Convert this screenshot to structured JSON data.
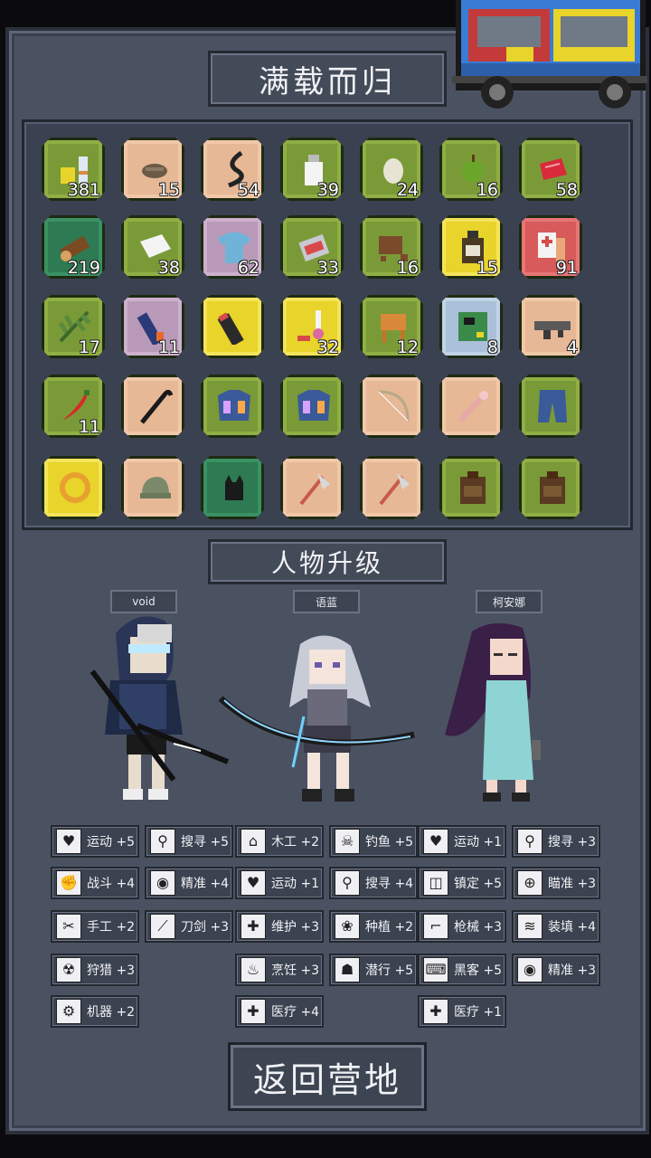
{
  "title": "满载而归",
  "section_title": "人物升级",
  "return_button": "返回营地",
  "inventory": [
    {
      "icon": "canned-food-bottle-icon",
      "count": "381",
      "bg": "g"
    },
    {
      "icon": "beef-jerky-icon",
      "count": "15",
      "bg": "t"
    },
    {
      "icon": "rope-icon",
      "count": "54",
      "bg": "t"
    },
    {
      "icon": "milk-bottle-icon",
      "count": "39",
      "bg": "g"
    },
    {
      "icon": "egg-icon",
      "count": "24",
      "bg": "g"
    },
    {
      "icon": "apple-icon",
      "count": "16",
      "bg": "g"
    },
    {
      "icon": "raw-meat-icon",
      "count": "58",
      "bg": "g"
    },
    {
      "icon": "wood-log-icon",
      "count": "219",
      "bg": "e"
    },
    {
      "icon": "cloth-icon",
      "count": "38",
      "bg": "g"
    },
    {
      "icon": "tshirt-icon",
      "count": "62",
      "bg": "p"
    },
    {
      "icon": "canned-meat-icon",
      "count": "33",
      "bg": "g"
    },
    {
      "icon": "chocolate-icon",
      "count": "16",
      "bg": "g"
    },
    {
      "icon": "medicine-bottle-icon",
      "count": "15",
      "bg": "y"
    },
    {
      "icon": "first-aid-icon",
      "count": "91",
      "bg": "r"
    },
    {
      "icon": "herb-icon",
      "count": "17",
      "bg": "g"
    },
    {
      "icon": "tube-icon",
      "count": "11",
      "bg": "p"
    },
    {
      "icon": "battery-icon",
      "count": "",
      "bg": "y"
    },
    {
      "icon": "chemical-vial-icon",
      "count": "32",
      "bg": "y"
    },
    {
      "icon": "wood-chip-icon",
      "count": "12",
      "bg": "g"
    },
    {
      "icon": "circuit-board-icon",
      "count": "8",
      "bg": "b"
    },
    {
      "icon": "rifle-icon",
      "count": "4",
      "bg": "t"
    },
    {
      "icon": "chili-pepper-icon",
      "count": "11",
      "bg": "g"
    },
    {
      "icon": "crowbar-icon",
      "count": "",
      "bg": "t"
    },
    {
      "icon": "jacket-icon",
      "count": "",
      "bg": "g"
    },
    {
      "icon": "jacket-icon",
      "count": "",
      "bg": "g"
    },
    {
      "icon": "bow-icon",
      "count": "",
      "bg": "t"
    },
    {
      "icon": "bone-club-icon",
      "count": "",
      "bg": "t"
    },
    {
      "icon": "pants-icon",
      "count": "",
      "bg": "g"
    },
    {
      "icon": "ring-icon",
      "count": "",
      "bg": "y"
    },
    {
      "icon": "cap-icon",
      "count": "",
      "bg": "t"
    },
    {
      "icon": "cat-icon",
      "count": "",
      "bg": "e"
    },
    {
      "icon": "axe-icon",
      "count": "",
      "bg": "t"
    },
    {
      "icon": "axe-icon",
      "count": "",
      "bg": "t"
    },
    {
      "icon": "backpack-icon",
      "count": "",
      "bg": "g"
    },
    {
      "icon": "backpack-icon",
      "count": "",
      "bg": "g"
    }
  ],
  "characters": [
    {
      "name": "void"
    },
    {
      "name": "语蓝"
    },
    {
      "name": "柯安娜"
    }
  ],
  "skills": [
    {
      "label": "运动 +5",
      "glyph": "♥",
      "icon": "heart-icon",
      "col": 0,
      "row": 0
    },
    {
      "label": "搜寻 +5",
      "glyph": "⚲",
      "icon": "magnifier-icon",
      "col": 1,
      "row": 0
    },
    {
      "label": "木工 +2",
      "glyph": "⌂",
      "icon": "house-icon",
      "col": 2,
      "row": 0
    },
    {
      "label": "钓鱼 +5",
      "glyph": "☠",
      "icon": "fish-icon",
      "col": 3,
      "row": 0
    },
    {
      "label": "运动 +1",
      "glyph": "♥",
      "icon": "heart-icon",
      "col": 4,
      "row": 0
    },
    {
      "label": "搜寻 +3",
      "glyph": "⚲",
      "icon": "magnifier-icon",
      "col": 5,
      "row": 0
    },
    {
      "label": "战斗 +4",
      "glyph": "✊",
      "icon": "fist-icon",
      "col": 0,
      "row": 1
    },
    {
      "label": "精准 +4",
      "glyph": "◉",
      "icon": "eye-icon",
      "col": 1,
      "row": 1
    },
    {
      "label": "运动 +1",
      "glyph": "♥",
      "icon": "heart-icon",
      "col": 2,
      "row": 1
    },
    {
      "label": "搜寻 +4",
      "glyph": "⚲",
      "icon": "magnifier-icon",
      "col": 3,
      "row": 1
    },
    {
      "label": "镇定 +5",
      "glyph": "◫",
      "icon": "glasses-icon",
      "col": 4,
      "row": 1
    },
    {
      "label": "瞄准 +3",
      "glyph": "⊕",
      "icon": "crosshair-icon",
      "col": 5,
      "row": 1
    },
    {
      "label": "手工 +2",
      "glyph": "✂",
      "icon": "scissors-icon",
      "col": 0,
      "row": 2
    },
    {
      "label": "刀剑 +3",
      "glyph": "⟋",
      "icon": "sword-icon",
      "col": 1,
      "row": 2
    },
    {
      "label": "维护 +3",
      "glyph": "✚",
      "icon": "wrench-icon",
      "col": 2,
      "row": 2
    },
    {
      "label": "种植 +2",
      "glyph": "❀",
      "icon": "plant-icon",
      "col": 3,
      "row": 2
    },
    {
      "label": "枪械 +3",
      "glyph": "⌐",
      "icon": "gun-icon",
      "col": 4,
      "row": 2
    },
    {
      "label": "装填 +4",
      "glyph": "≋",
      "icon": "ammo-icon",
      "col": 5,
      "row": 2
    },
    {
      "label": "狩猎 +3",
      "glyph": "☢",
      "icon": "hunting-icon",
      "col": 0,
      "row": 3
    },
    {
      "label": "烹饪 +3",
      "glyph": "♨",
      "icon": "cooking-pot-icon",
      "col": 2,
      "row": 3
    },
    {
      "label": "潜行 +5",
      "glyph": "☗",
      "icon": "sneak-icon",
      "col": 3,
      "row": 3
    },
    {
      "label": "黑客 +5",
      "glyph": "⌨",
      "icon": "hacker-icon",
      "col": 4,
      "row": 3
    },
    {
      "label": "精准 +3",
      "glyph": "◉",
      "icon": "eye-icon",
      "col": 5,
      "row": 3
    },
    {
      "label": "机器 +2",
      "glyph": "⚙",
      "icon": "gear-icon",
      "col": 0,
      "row": 4
    },
    {
      "label": "医疗 +4",
      "glyph": "✚",
      "icon": "medkit-icon",
      "col": 2,
      "row": 4
    },
    {
      "label": "医疗 +1",
      "glyph": "✚",
      "icon": "medkit-icon",
      "col": 4,
      "row": 4
    }
  ]
}
